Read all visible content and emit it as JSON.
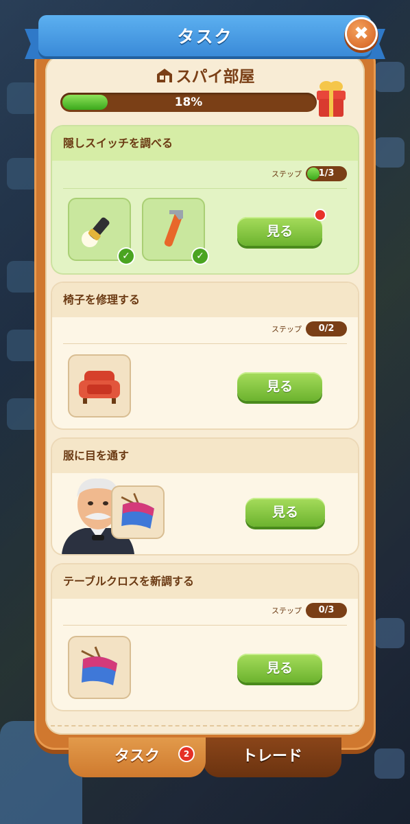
{
  "window": {
    "title": "タスク",
    "close_label": "✖"
  },
  "room": {
    "name": "スパイ部屋",
    "progress_label": "18%",
    "progress_fraction": 0.18
  },
  "tasks": [
    {
      "title": "隠しスイッチを調べる",
      "step_label": "ステップ",
      "step_value": "1/3",
      "step_fraction": 0.33,
      "button": "見る",
      "items": [
        "flashlight-icon",
        "wrench-icon"
      ]
    },
    {
      "title": "椅子を修理する",
      "step_label": "ステップ",
      "step_value": "0/2",
      "step_fraction": 0,
      "button": "見る",
      "items": [
        "armchair-icon"
      ]
    },
    {
      "title": "服に目を通す",
      "button": "見る",
      "items": [
        "butler-avatar",
        "knitting-icon"
      ]
    },
    {
      "title": "テーブルクロスを新調する",
      "step_label": "ステップ",
      "step_value": "0/3",
      "step_fraction": 0,
      "button": "見る",
      "items": [
        "knitting-icon"
      ]
    }
  ],
  "tabs": {
    "task": "タスク",
    "task_badge": "2",
    "trade": "トレード"
  },
  "colors": {
    "ribbon": "#3a8ad8",
    "panel": "#d0782f",
    "button_green": "#6cb32e",
    "progress_bar": "#7a3f16"
  }
}
